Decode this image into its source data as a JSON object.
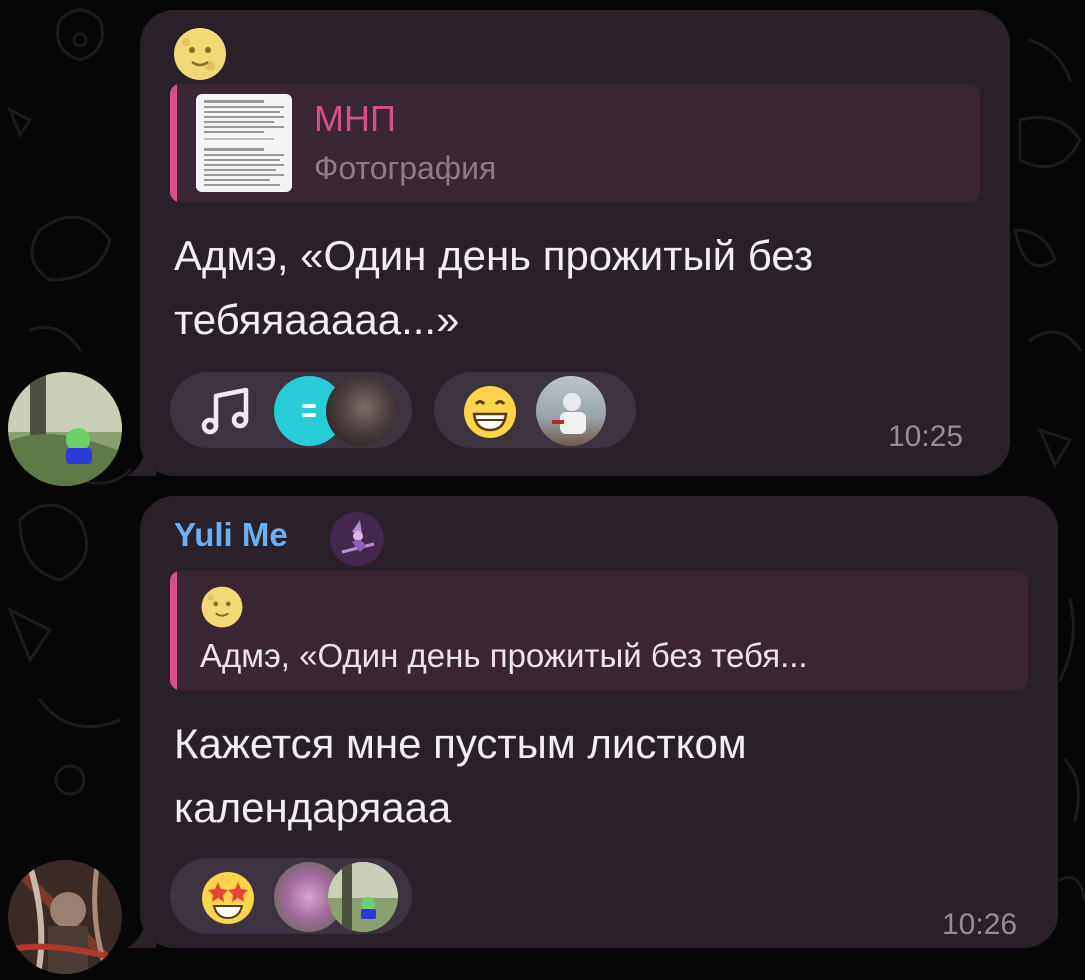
{
  "messages": [
    {
      "reply": {
        "title": "МНП",
        "subtitle": "Фотография"
      },
      "text": "Адмэ, «Один день прожитый без тебяяааааа...»",
      "reactions": [
        {
          "icon": "music-note-icon"
        },
        {
          "icon": "emoji-grinning-face"
        }
      ],
      "time": "10:25"
    },
    {
      "sender": "Yuli Me",
      "reply": {
        "text": "Адмэ, «Один день прожитый без тебя..."
      },
      "text": "Кажется мне пустым листком календаряааа",
      "reactions": [
        {
          "icon": "emoji-star-struck"
        }
      ],
      "time": "10:26"
    }
  ],
  "colors": {
    "bubble": "#2a2029",
    "reply_accent": "#d64f8e",
    "sender_name": "#6cb0f2",
    "background": "#060606"
  }
}
